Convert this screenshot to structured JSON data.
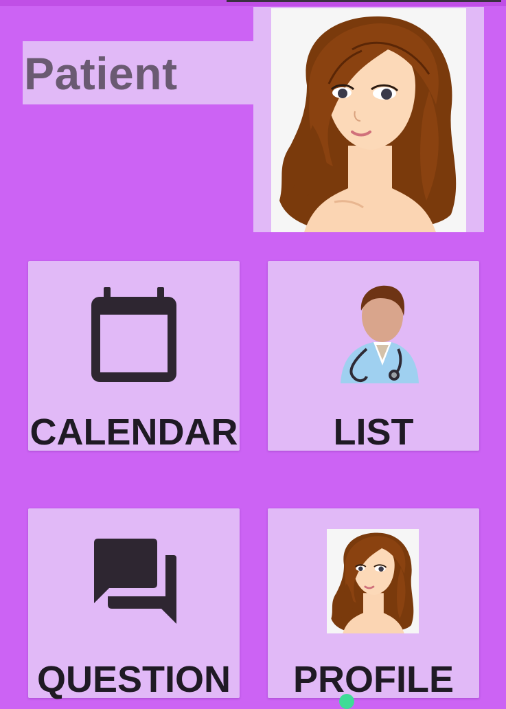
{
  "app": {
    "title": "Patient"
  },
  "header": {
    "avatar_icon": "female-avatar-icon"
  },
  "tiles": [
    {
      "label": "CALENDAR",
      "icon": "calendar-icon"
    },
    {
      "label": "LIST",
      "icon": "doctor-icon"
    },
    {
      "label": "QUESTION",
      "icon": "chat-icon"
    },
    {
      "label": "PROFILE",
      "icon": "female-avatar-icon"
    }
  ],
  "colors": {
    "background": "#cc63f4",
    "tile": "#e1b9f7",
    "title_text": "#6a5a72",
    "label_text": "#1f1a24",
    "icon_dark": "#2e2631"
  }
}
